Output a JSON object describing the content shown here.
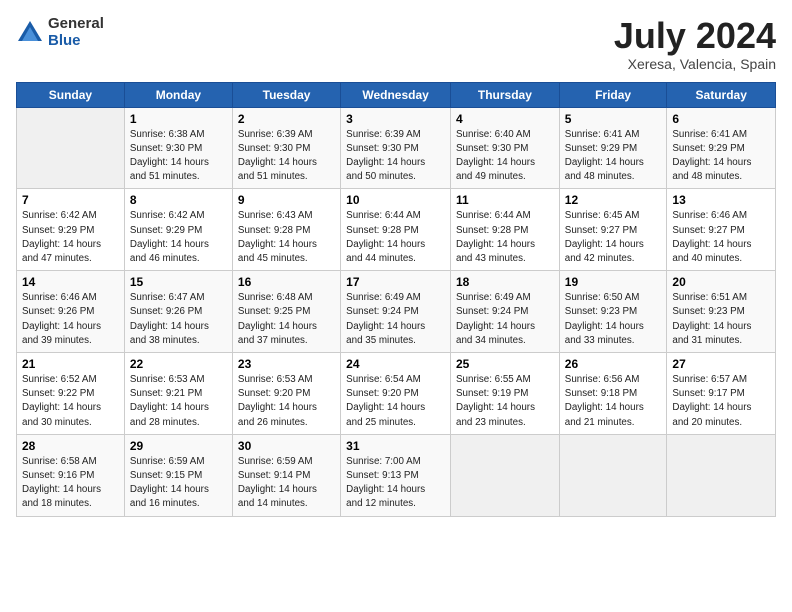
{
  "logo": {
    "general": "General",
    "blue": "Blue"
  },
  "title": "July 2024",
  "subtitle": "Xeresa, Valencia, Spain",
  "days_header": [
    "Sunday",
    "Monday",
    "Tuesday",
    "Wednesday",
    "Thursday",
    "Friday",
    "Saturday"
  ],
  "weeks": [
    [
      {
        "num": "",
        "info": ""
      },
      {
        "num": "1",
        "info": "Sunrise: 6:38 AM\nSunset: 9:30 PM\nDaylight: 14 hours\nand 51 minutes."
      },
      {
        "num": "2",
        "info": "Sunrise: 6:39 AM\nSunset: 9:30 PM\nDaylight: 14 hours\nand 51 minutes."
      },
      {
        "num": "3",
        "info": "Sunrise: 6:39 AM\nSunset: 9:30 PM\nDaylight: 14 hours\nand 50 minutes."
      },
      {
        "num": "4",
        "info": "Sunrise: 6:40 AM\nSunset: 9:30 PM\nDaylight: 14 hours\nand 49 minutes."
      },
      {
        "num": "5",
        "info": "Sunrise: 6:41 AM\nSunset: 9:29 PM\nDaylight: 14 hours\nand 48 minutes."
      },
      {
        "num": "6",
        "info": "Sunrise: 6:41 AM\nSunset: 9:29 PM\nDaylight: 14 hours\nand 48 minutes."
      }
    ],
    [
      {
        "num": "7",
        "info": "Sunrise: 6:42 AM\nSunset: 9:29 PM\nDaylight: 14 hours\nand 47 minutes."
      },
      {
        "num": "8",
        "info": "Sunrise: 6:42 AM\nSunset: 9:29 PM\nDaylight: 14 hours\nand 46 minutes."
      },
      {
        "num": "9",
        "info": "Sunrise: 6:43 AM\nSunset: 9:28 PM\nDaylight: 14 hours\nand 45 minutes."
      },
      {
        "num": "10",
        "info": "Sunrise: 6:44 AM\nSunset: 9:28 PM\nDaylight: 14 hours\nand 44 minutes."
      },
      {
        "num": "11",
        "info": "Sunrise: 6:44 AM\nSunset: 9:28 PM\nDaylight: 14 hours\nand 43 minutes."
      },
      {
        "num": "12",
        "info": "Sunrise: 6:45 AM\nSunset: 9:27 PM\nDaylight: 14 hours\nand 42 minutes."
      },
      {
        "num": "13",
        "info": "Sunrise: 6:46 AM\nSunset: 9:27 PM\nDaylight: 14 hours\nand 40 minutes."
      }
    ],
    [
      {
        "num": "14",
        "info": "Sunrise: 6:46 AM\nSunset: 9:26 PM\nDaylight: 14 hours\nand 39 minutes."
      },
      {
        "num": "15",
        "info": "Sunrise: 6:47 AM\nSunset: 9:26 PM\nDaylight: 14 hours\nand 38 minutes."
      },
      {
        "num": "16",
        "info": "Sunrise: 6:48 AM\nSunset: 9:25 PM\nDaylight: 14 hours\nand 37 minutes."
      },
      {
        "num": "17",
        "info": "Sunrise: 6:49 AM\nSunset: 9:24 PM\nDaylight: 14 hours\nand 35 minutes."
      },
      {
        "num": "18",
        "info": "Sunrise: 6:49 AM\nSunset: 9:24 PM\nDaylight: 14 hours\nand 34 minutes."
      },
      {
        "num": "19",
        "info": "Sunrise: 6:50 AM\nSunset: 9:23 PM\nDaylight: 14 hours\nand 33 minutes."
      },
      {
        "num": "20",
        "info": "Sunrise: 6:51 AM\nSunset: 9:23 PM\nDaylight: 14 hours\nand 31 minutes."
      }
    ],
    [
      {
        "num": "21",
        "info": "Sunrise: 6:52 AM\nSunset: 9:22 PM\nDaylight: 14 hours\nand 30 minutes."
      },
      {
        "num": "22",
        "info": "Sunrise: 6:53 AM\nSunset: 9:21 PM\nDaylight: 14 hours\nand 28 minutes."
      },
      {
        "num": "23",
        "info": "Sunrise: 6:53 AM\nSunset: 9:20 PM\nDaylight: 14 hours\nand 26 minutes."
      },
      {
        "num": "24",
        "info": "Sunrise: 6:54 AM\nSunset: 9:20 PM\nDaylight: 14 hours\nand 25 minutes."
      },
      {
        "num": "25",
        "info": "Sunrise: 6:55 AM\nSunset: 9:19 PM\nDaylight: 14 hours\nand 23 minutes."
      },
      {
        "num": "26",
        "info": "Sunrise: 6:56 AM\nSunset: 9:18 PM\nDaylight: 14 hours\nand 21 minutes."
      },
      {
        "num": "27",
        "info": "Sunrise: 6:57 AM\nSunset: 9:17 PM\nDaylight: 14 hours\nand 20 minutes."
      }
    ],
    [
      {
        "num": "28",
        "info": "Sunrise: 6:58 AM\nSunset: 9:16 PM\nDaylight: 14 hours\nand 18 minutes."
      },
      {
        "num": "29",
        "info": "Sunrise: 6:59 AM\nSunset: 9:15 PM\nDaylight: 14 hours\nand 16 minutes."
      },
      {
        "num": "30",
        "info": "Sunrise: 6:59 AM\nSunset: 9:14 PM\nDaylight: 14 hours\nand 14 minutes."
      },
      {
        "num": "31",
        "info": "Sunrise: 7:00 AM\nSunset: 9:13 PM\nDaylight: 14 hours\nand 12 minutes."
      },
      {
        "num": "",
        "info": ""
      },
      {
        "num": "",
        "info": ""
      },
      {
        "num": "",
        "info": ""
      }
    ]
  ]
}
